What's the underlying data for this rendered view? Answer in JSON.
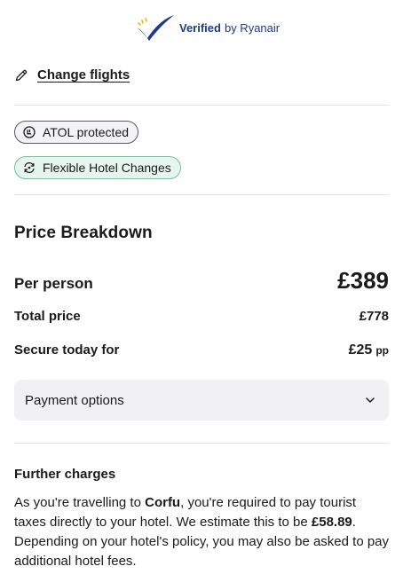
{
  "verified": {
    "strong": "Verified",
    "light": "by Ryanair"
  },
  "change_flights": {
    "label": "Change flights",
    "icon": "pencil-icon"
  },
  "chips": [
    {
      "label": "ATOL protected",
      "icon": "atol-icon"
    },
    {
      "label": "Flexible Hotel Changes",
      "icon": "refresh-icon"
    }
  ],
  "price_breakdown": {
    "title": "Price Breakdown",
    "per_person_label": "Per person",
    "per_person_value": "£389",
    "total_label": "Total price",
    "total_value": "£778",
    "secure_label": "Secure today for",
    "secure_value": "£25",
    "secure_unit": "pp"
  },
  "payment_options": {
    "label": "Payment options",
    "icon": "chevron-down-icon"
  },
  "further_charges": {
    "title": "Further charges",
    "text_1": "As you're travelling to ",
    "destination": "Corfu",
    "text_2": ", you're required to pay tourist taxes directly to your hotel. We estimate this to be ",
    "amount": "£58.89",
    "text_3": ". Depending on your hotel's policy, you may also be asked to pay additional hotel fees."
  },
  "colors": {
    "brand": "#1d3a8f",
    "chip_green_bg": "#e6f6ee",
    "chip_green_border": "#6cc49a",
    "panel_bg": "#f1f1f5"
  }
}
